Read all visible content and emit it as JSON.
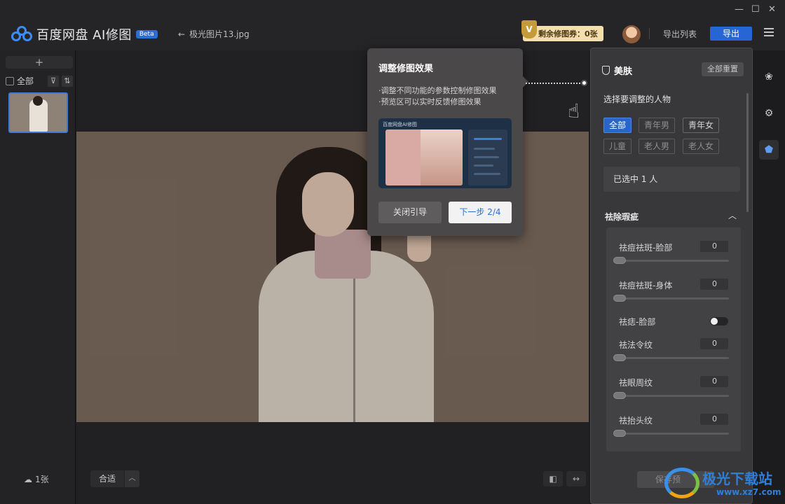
{
  "app": {
    "name": "百度网盘 AI修图",
    "badge": "Beta"
  },
  "header": {
    "back_label": "极光图片13.jpg",
    "coupon_label": "剩余修图券：0张",
    "coupon_icon": "V",
    "export_list": "导出列表",
    "export": "导出"
  },
  "window_controls": [
    "—",
    "☐",
    "✕"
  ],
  "left": {
    "add": "+",
    "select_all": "全部",
    "count": "1张"
  },
  "canvas": {
    "zoom_label": "合适"
  },
  "guide": {
    "title": "调整修图效果",
    "lines": [
      "·调整不同功能的参数控制修图效果",
      "·预览区可以实时反馈修图效果"
    ],
    "preview_caption": "百度网盘AI修图",
    "close": "关闭引导",
    "next": "下一步 2/4"
  },
  "panel": {
    "title": "美肤",
    "reset_all": "全部重置",
    "choose_person": "选择要调整的人物",
    "chips": [
      {
        "label": "全部",
        "state": "active"
      },
      {
        "label": "青年男",
        "state": "disabled"
      },
      {
        "label": "青年女",
        "state": "normal"
      },
      {
        "label": "儿童",
        "state": "disabled"
      },
      {
        "label": "老人男",
        "state": "disabled"
      },
      {
        "label": "老人女",
        "state": "disabled"
      }
    ],
    "selected": "已选中 1 人",
    "section": "祛除瑕疵",
    "params": [
      {
        "label": "祛痘祛斑-脸部",
        "value": "0"
      },
      {
        "label": "祛痘祛斑-身体",
        "value": "0"
      },
      {
        "label": "祛痣-脸部",
        "toggle": true
      },
      {
        "label": "祛法令纹",
        "value": "0"
      },
      {
        "label": "祛眼周纹",
        "value": "0"
      },
      {
        "label": "祛抬头纹",
        "value": "0"
      }
    ],
    "save": "保存预"
  },
  "watermark": {
    "name": "极光下载站",
    "url": "www.xz7.com"
  }
}
